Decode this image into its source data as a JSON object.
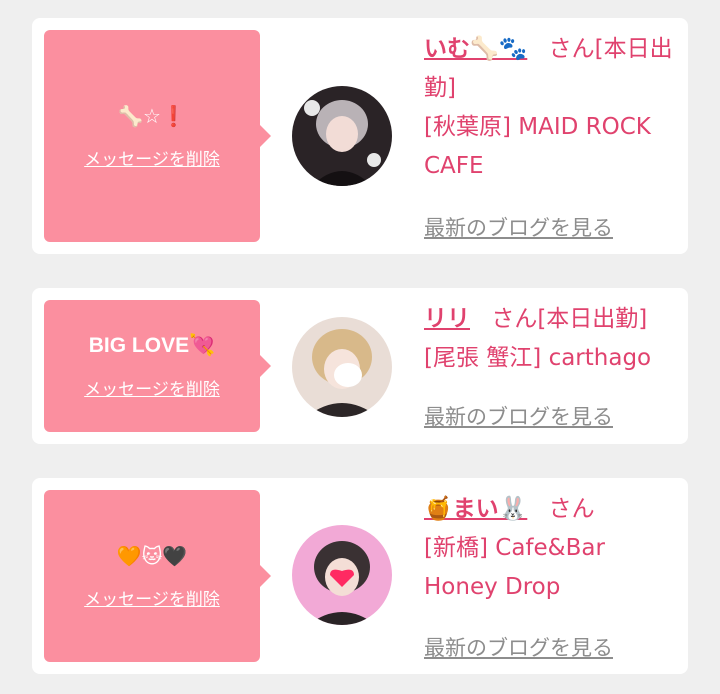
{
  "cards": [
    {
      "message": "🦴☆❗",
      "delete_label": "メッセージを削除",
      "name": "いむ🦴🐾",
      "honorific": "さん",
      "status": "[本日出勤]",
      "shop": "[秋葉原] MAID ROCK CAFE",
      "blog_label": "最新のブログを見る"
    },
    {
      "message": "BIG LOVE💘",
      "delete_label": "メッセージを削除",
      "name": "リリ",
      "honorific": "さん",
      "status": "[本日出勤]",
      "shop": "[尾張 蟹江] carthago",
      "blog_label": "最新のブログを見る"
    },
    {
      "message": "🧡🐱🖤",
      "delete_label": "メッセージを削除",
      "name": "🍯まい🐰",
      "honorific": "さん",
      "status": "",
      "shop": "[新橋] Cafe&Bar Honey Drop",
      "blog_label": "最新のブログを見る"
    }
  ],
  "colors": {
    "background": "#efefef",
    "bubble": "#fb8f9f",
    "accent_text": "#e0426e",
    "link_gray": "#8d8d8d"
  }
}
